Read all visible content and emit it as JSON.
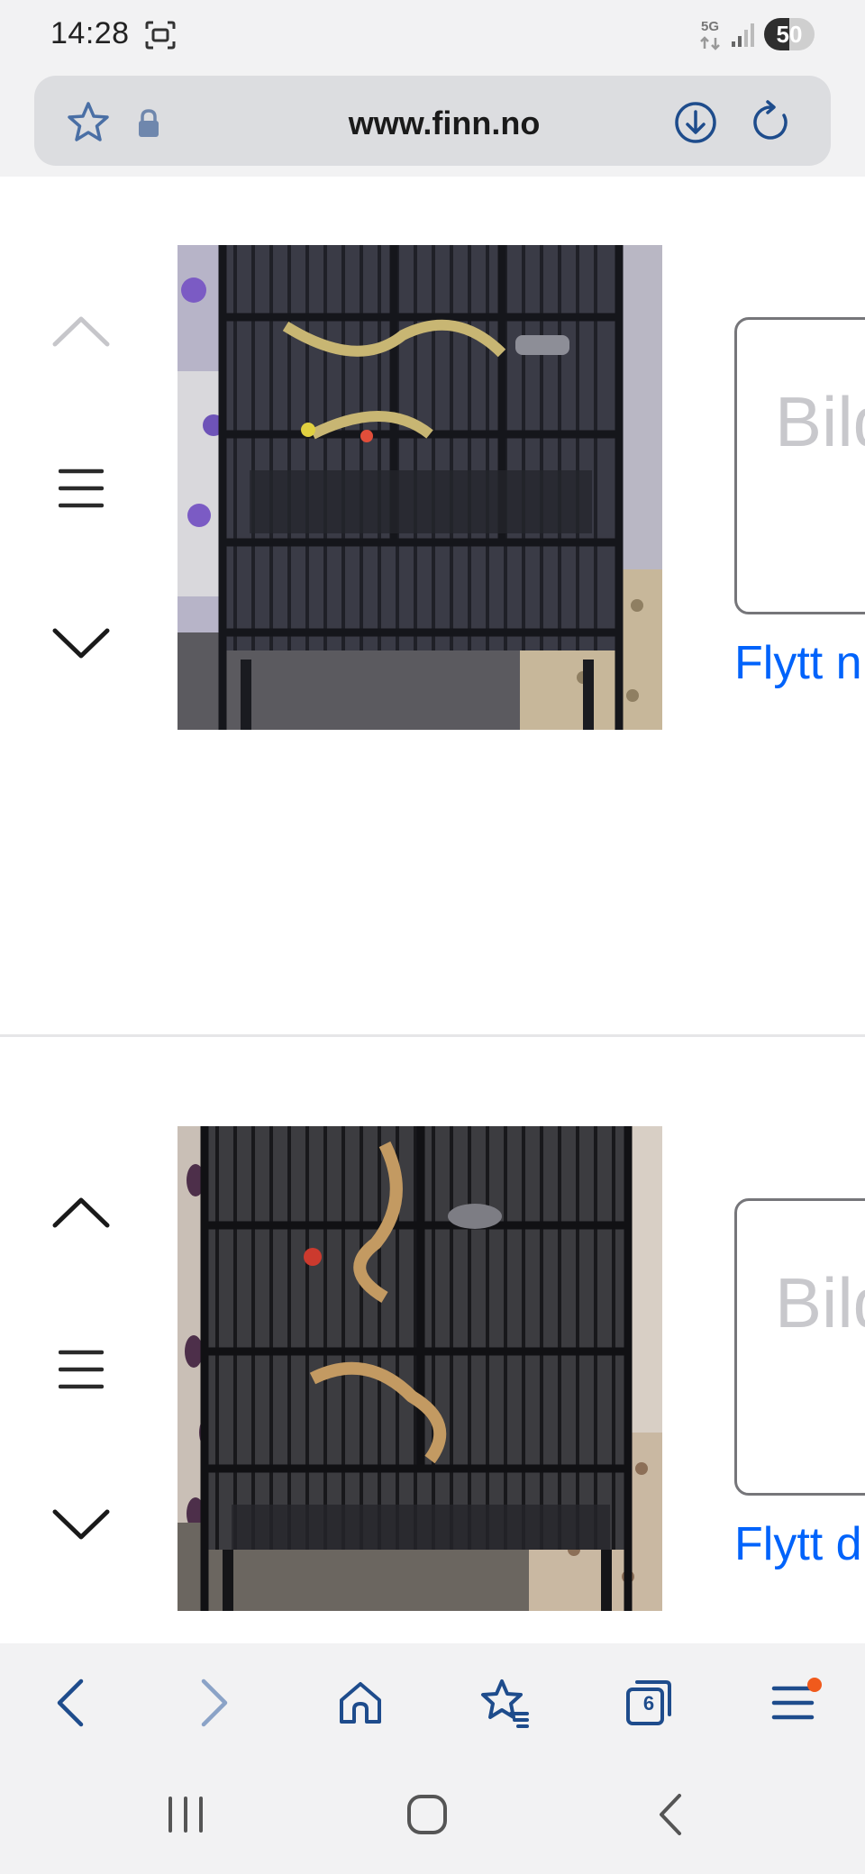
{
  "status_bar": {
    "time": "14:28",
    "network": "5G",
    "battery_level": "50",
    "battery_fraction": 0.5
  },
  "browser": {
    "url": "www.finn.no",
    "tabs_count": "6",
    "accent_color": "#1e4c8c",
    "menu_notification_color": "#f05a1c"
  },
  "images": [
    {
      "caption_placeholder": "Bild",
      "move_link": "Flytt n",
      "up_enabled": false,
      "down_enabled": true
    },
    {
      "caption_placeholder": "Bild",
      "move_link": "Flytt d",
      "up_enabled": true,
      "down_enabled": true
    }
  ],
  "colors": {
    "link": "#0063fb",
    "placeholder": "#c8c8cc",
    "disabled_arrow": "#c6c6ca"
  },
  "icons": [
    "screenshot-icon",
    "signal-icon",
    "star-icon",
    "lock-icon",
    "download-icon",
    "reload-icon",
    "chevron-up-icon",
    "drag-handle-icon",
    "chevron-down-icon",
    "back-icon",
    "forward-icon",
    "home-icon",
    "bookmarks-icon",
    "tabs-icon",
    "menu-icon",
    "recents-icon",
    "home-button-icon",
    "system-back-icon"
  ]
}
